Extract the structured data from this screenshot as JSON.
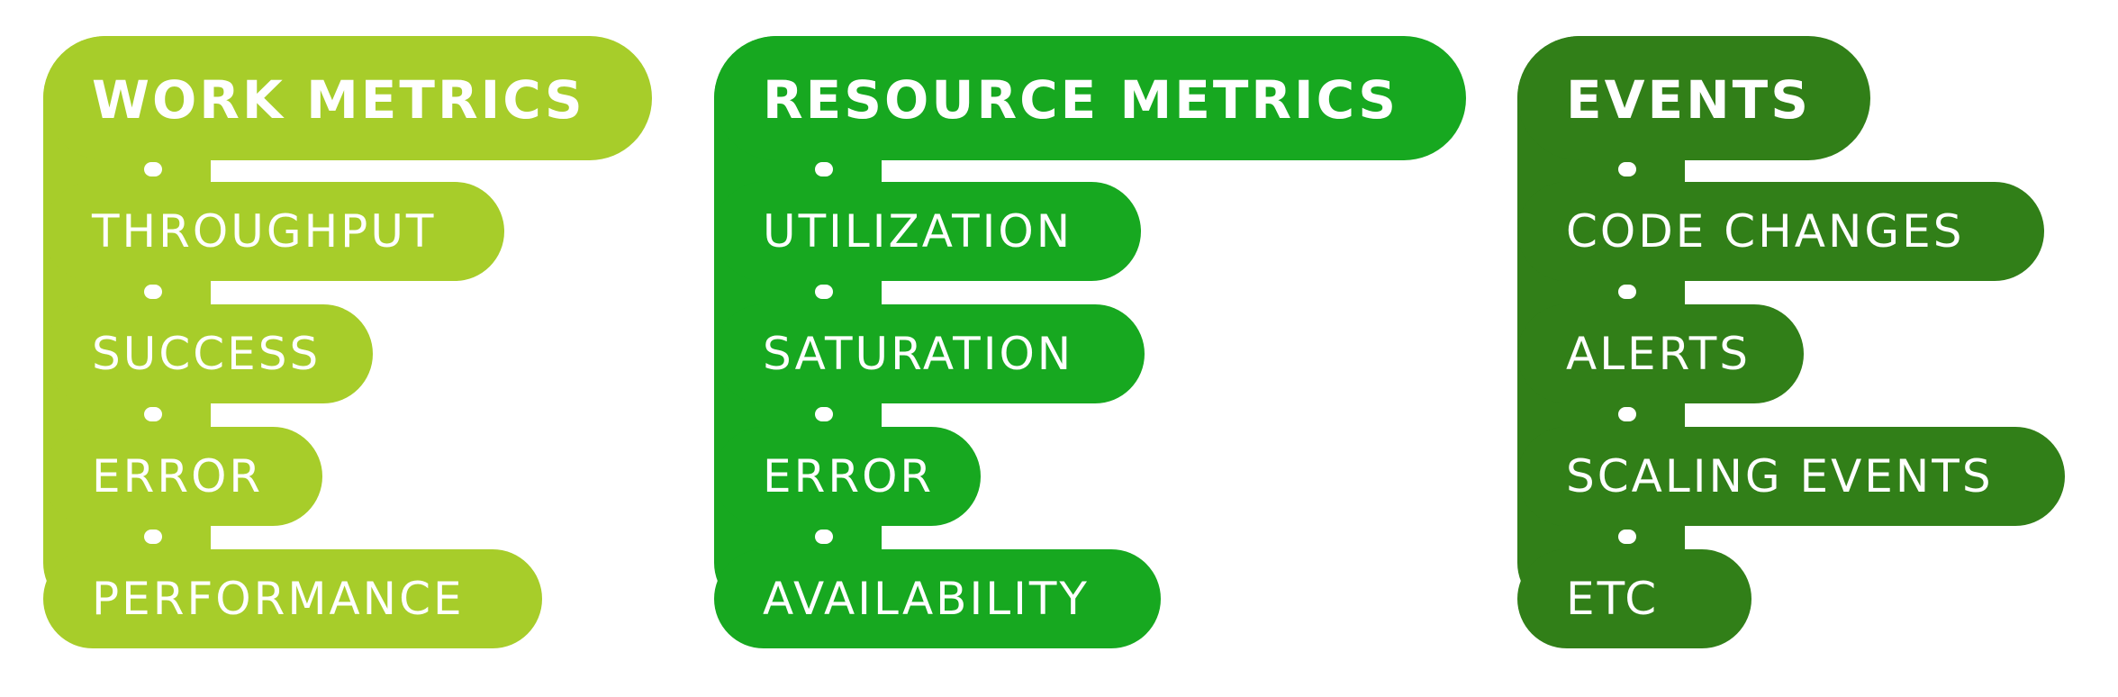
{
  "colors": {
    "work": "#a7cd2a",
    "resource": "#17a820",
    "events": "#317f18"
  },
  "columns": [
    {
      "title": "WORK METRICS",
      "items": [
        "THROUGHPUT",
        "SUCCESS",
        "ERROR",
        "PERFORMANCE"
      ]
    },
    {
      "title": "RESOURCE METRICS",
      "items": [
        "UTILIZATION",
        "SATURATION",
        "ERROR",
        "AVAILABILITY"
      ]
    },
    {
      "title": "EVENTS",
      "items": [
        "CODE CHANGES",
        "ALERTS",
        "SCALING EVENTS",
        "ETC"
      ]
    }
  ]
}
